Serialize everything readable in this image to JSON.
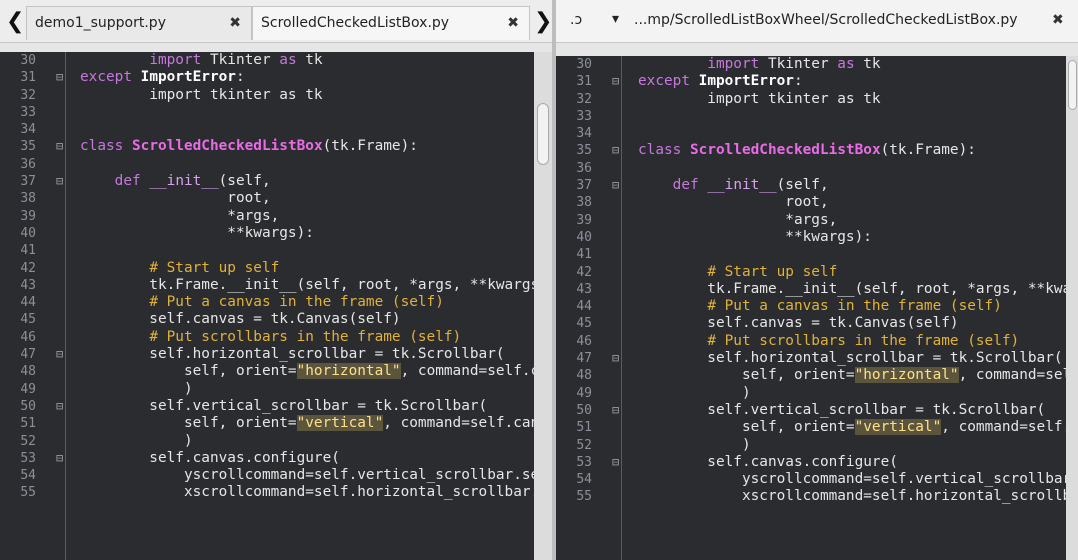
{
  "left": {
    "nav_left": "❮",
    "tabs": [
      {
        "label": "demo1_support.py",
        "close": "✖"
      },
      {
        "label": "ScrolledCheckedListBox.py",
        "close": "✖"
      }
    ],
    "nav_right": "❯"
  },
  "right": {
    "refresh": ".ↄ",
    "dropdown": "▾",
    "title": "...mp/ScrolledListBoxWheel/ScrolledCheckedListBox.py",
    "close": "✖"
  },
  "code_lines": [
    {
      "n": "30",
      "segs": [
        [
          "p",
          "        "
        ],
        [
          "kw",
          "import"
        ],
        [
          "p",
          " Tkinter "
        ],
        [
          "kw",
          "as"
        ],
        [
          "p",
          " tk"
        ]
      ]
    },
    {
      "n": "31",
      "fold": "⊟",
      "segs": [
        [
          "kw",
          "except"
        ],
        [
          "p",
          " "
        ],
        [
          "kwb",
          "ImportError"
        ],
        [
          "p",
          ":"
        ]
      ]
    },
    {
      "n": "32",
      "segs": [
        [
          "p",
          "        import tkinter as tk"
        ]
      ]
    },
    {
      "n": "33",
      "segs": []
    },
    {
      "n": "34",
      "segs": []
    },
    {
      "n": "35",
      "fold": "⊟",
      "segs": [
        [
          "kw",
          "class"
        ],
        [
          "p",
          " "
        ],
        [
          "cls",
          "ScrolledCheckedListBox"
        ],
        [
          "p",
          "(tk.Frame):"
        ]
      ]
    },
    {
      "n": "36",
      "segs": []
    },
    {
      "n": "37",
      "fold": "⊟",
      "segs": [
        [
          "p",
          "    "
        ],
        [
          "kw",
          "def"
        ],
        [
          "p",
          " "
        ],
        [
          "fn",
          "__init__"
        ],
        [
          "p",
          "(self,"
        ]
      ]
    },
    {
      "n": "38",
      "segs": [
        [
          "p",
          "                 root,"
        ]
      ]
    },
    {
      "n": "39",
      "segs": [
        [
          "p",
          "                 *args,"
        ]
      ]
    },
    {
      "n": "40",
      "segs": [
        [
          "p",
          "                 **kwargs):"
        ]
      ]
    },
    {
      "n": "41",
      "segs": []
    },
    {
      "n": "42",
      "segs": [
        [
          "p",
          "        "
        ],
        [
          "cm",
          "# Start up self"
        ]
      ]
    },
    {
      "n": "43",
      "segs": [
        [
          "p",
          "        tk.Frame.__init__(self, root, *args, **kwargs)"
        ]
      ]
    },
    {
      "n": "44",
      "segs": [
        [
          "p",
          "        "
        ],
        [
          "cm",
          "# Put a canvas in the frame (self)"
        ]
      ]
    },
    {
      "n": "45",
      "segs": [
        [
          "p",
          "        self.canvas = tk.Canvas(self)"
        ]
      ]
    },
    {
      "n": "46",
      "segs": [
        [
          "p",
          "        "
        ],
        [
          "cm",
          "# Put scrollbars in the frame (self)"
        ]
      ]
    },
    {
      "n": "47",
      "fold": "⊟",
      "segs": [
        [
          "p",
          "        self.horizontal_scrollbar = tk.Scrollbar("
        ]
      ]
    },
    {
      "n": "48",
      "segs": [
        [
          "p",
          "            self, orient="
        ],
        [
          "str",
          "\"horizontal\""
        ],
        [
          "p",
          ", command=self.canvas.xview)"
        ]
      ]
    },
    {
      "n": "49",
      "segs": [
        [
          "p",
          "            )"
        ]
      ]
    },
    {
      "n": "50",
      "fold": "⊟",
      "segs": [
        [
          "p",
          "        self.vertical_scrollbar = tk.Scrollbar("
        ]
      ]
    },
    {
      "n": "51",
      "segs": [
        [
          "p",
          "            self, orient="
        ],
        [
          "str",
          "\"vertical\""
        ],
        [
          "p",
          ", command=self.canvas.yview)"
        ]
      ]
    },
    {
      "n": "52",
      "segs": [
        [
          "p",
          "            )"
        ]
      ]
    },
    {
      "n": "53",
      "fold": "⊟",
      "segs": [
        [
          "p",
          "        self.canvas.configure("
        ]
      ]
    },
    {
      "n": "54",
      "segs": [
        [
          "p",
          "            yscrollcommand=self.vertical_scrollbar.set,"
        ]
      ]
    },
    {
      "n": "55",
      "segs": [
        [
          "p",
          "            xscrollcommand=self.horizontal_scrollbar.set)"
        ]
      ]
    }
  ],
  "vscroll_fraction": 0.1
}
